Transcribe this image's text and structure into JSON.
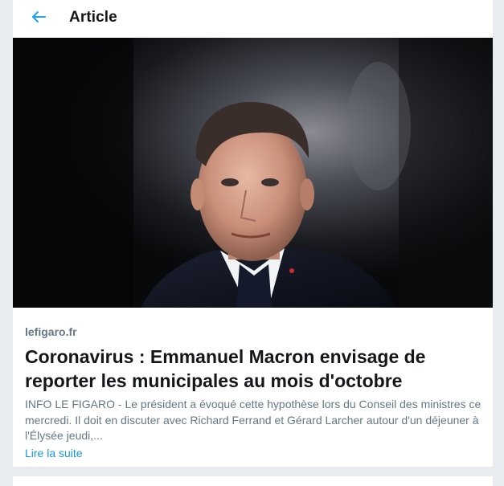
{
  "header": {
    "back_icon": "arrow-left-icon",
    "title": "Article"
  },
  "article": {
    "image_icon": "photo-portrait",
    "source": "lefigaro.fr",
    "headline": "Coronavirus : Emmanuel Macron envisage de reporter les municipales au mois d'octobre",
    "summary": "INFO LE FIGARO - Le président a évoqué cette hypothèse lors du Conseil des ministres ce mercredi. Il doit en discuter avec Richard Ferrand et Gérard Larcher autour d'un déjeuner à l'Élysée jeudi,...",
    "read_more": "Lire la suite"
  },
  "colors": {
    "accent": "#1b95e0",
    "text_primary": "#14171a",
    "text_secondary": "#657786",
    "background": "#e6ecf0"
  }
}
